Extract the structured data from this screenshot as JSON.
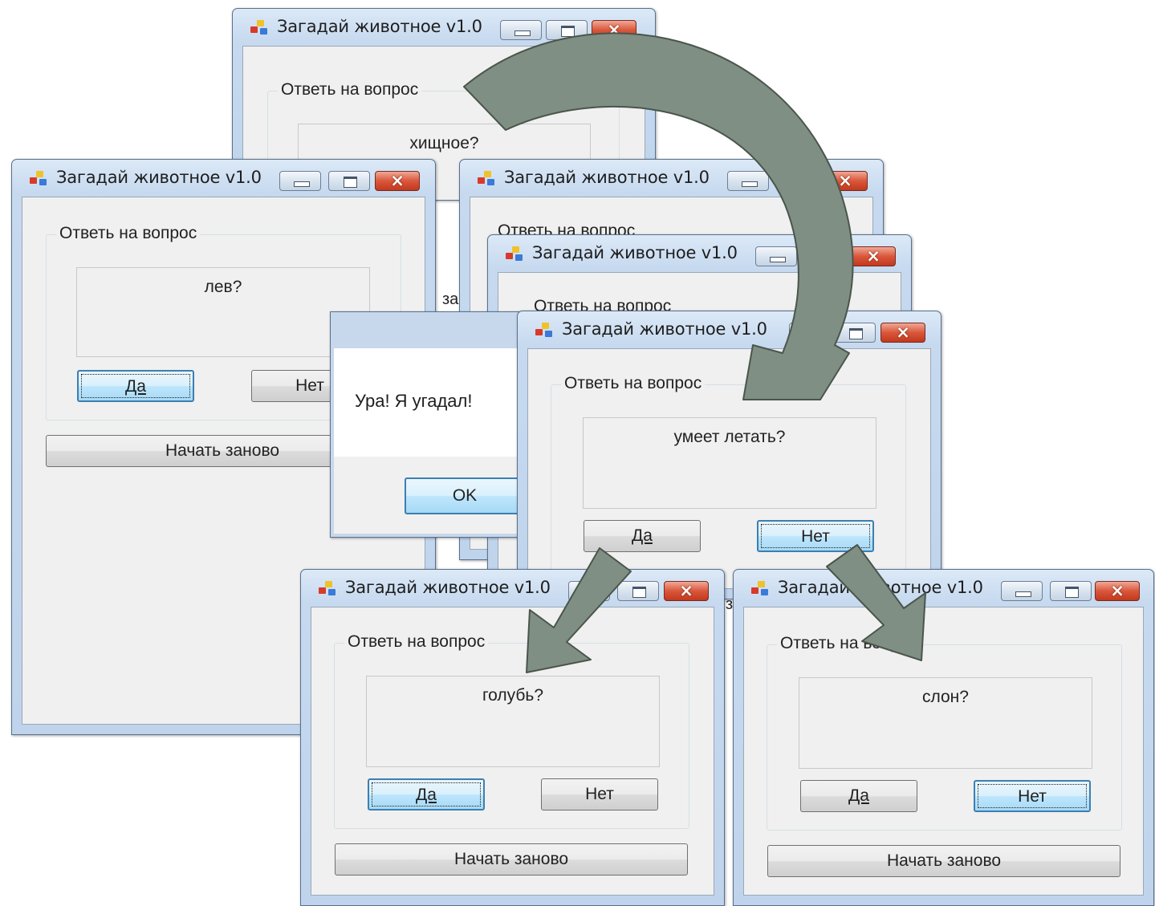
{
  "app_title": "Загадай животное v1.0",
  "group_label": "Ответь на вопрос",
  "yes_label": "Да",
  "no_label": "Нет",
  "restart_label": "Начать заново",
  "ok_label": "OK",
  "msg_text": "Ура! Я угадал!",
  "frag_partial": "за",
  "frag_partial2": "з",
  "frag_label_partial": "Ответь на вопрос",
  "questions": {
    "root": "хищное?",
    "lion": "лев?",
    "flies": "умеет летать?",
    "pigeon": "голубь?",
    "elephant": "слон?"
  },
  "arrow_color": "#7f8f83"
}
